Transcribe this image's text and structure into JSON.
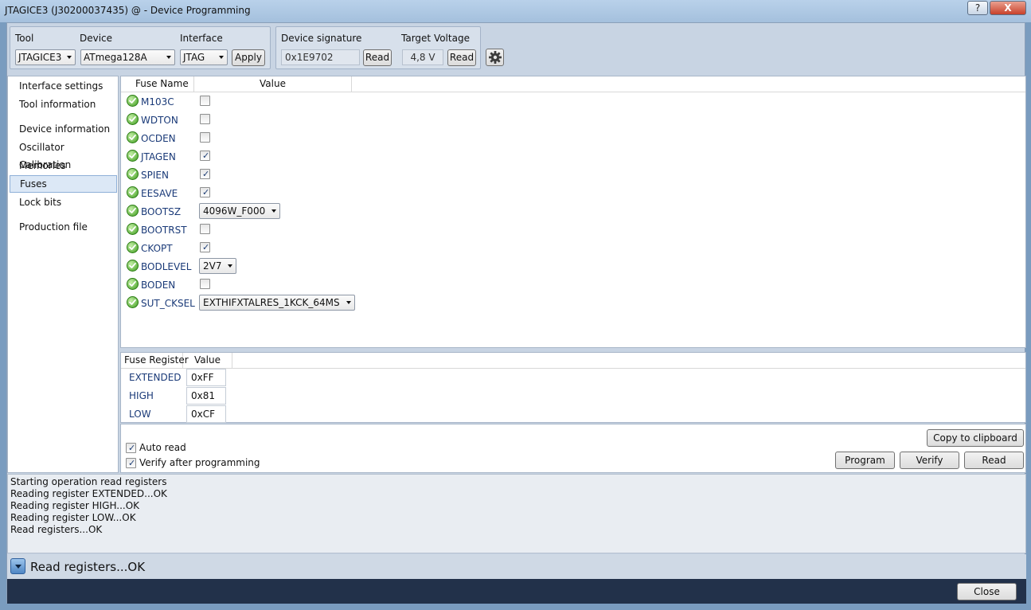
{
  "window": {
    "title": "JTAGICE3 (J30200037435) @  - Device Programming",
    "help_label": "?",
    "close_label": "X"
  },
  "toolbar": {
    "tool_label": "Tool",
    "tool_value": "JTAGICE3",
    "device_label": "Device",
    "device_value": "ATmega128A",
    "interface_label": "Interface",
    "interface_value": "JTAG",
    "apply_label": "Apply",
    "signature_label": "Device signature",
    "signature_value": "0x1E9702",
    "signature_read_label": "Read",
    "voltage_label": "Target Voltage",
    "voltage_value": "4,8 V",
    "voltage_read_label": "Read",
    "settings_icon": "gear-icon"
  },
  "sidebar": {
    "items": [
      {
        "label": "Interface settings"
      },
      {
        "label": "Tool information"
      },
      {
        "label": "Device information"
      },
      {
        "label": "Oscillator Calibration"
      },
      {
        "label": "Memories"
      },
      {
        "label": "Fuses",
        "selected": true
      },
      {
        "label": "Lock bits"
      },
      {
        "label": "Production file"
      }
    ]
  },
  "fuses": {
    "columns": {
      "name": "Fuse Name",
      "value": "Value"
    },
    "status_icon": "check-circle-icon",
    "rows": [
      {
        "name": "M103C",
        "type": "checkbox",
        "checked": false
      },
      {
        "name": "WDTON",
        "type": "checkbox",
        "checked": false
      },
      {
        "name": "OCDEN",
        "type": "checkbox",
        "checked": false
      },
      {
        "name": "JTAGEN",
        "type": "checkbox",
        "checked": true
      },
      {
        "name": "SPIEN",
        "type": "checkbox",
        "checked": true
      },
      {
        "name": "EESAVE",
        "type": "checkbox",
        "checked": true
      },
      {
        "name": "BOOTSZ",
        "type": "select",
        "value": "4096W_F000"
      },
      {
        "name": "BOOTRST",
        "type": "checkbox",
        "checked": false
      },
      {
        "name": "CKOPT",
        "type": "checkbox",
        "checked": true
      },
      {
        "name": "BODLEVEL",
        "type": "select",
        "value": "2V7"
      },
      {
        "name": "BODEN",
        "type": "checkbox",
        "checked": false
      },
      {
        "name": "SUT_CKSEL",
        "type": "select",
        "value": "EXTHIFXTALRES_1KCK_64MS"
      }
    ]
  },
  "registers": {
    "columns": {
      "name": "Fuse Register",
      "value": "Value"
    },
    "rows": [
      {
        "name": "EXTENDED",
        "value": "0xFF"
      },
      {
        "name": "HIGH",
        "value": "0x81"
      },
      {
        "name": "LOW",
        "value": "0xCF"
      }
    ]
  },
  "actions": {
    "auto_read_label": "Auto read",
    "auto_read_checked": true,
    "verify_label": "Verify after programming",
    "verify_checked": true,
    "copy_label": "Copy to clipboard",
    "program_label": "Program",
    "verify_button_label": "Verify",
    "read_label": "Read"
  },
  "log": {
    "lines": [
      "Starting operation read registers",
      "Reading register EXTENDED...OK",
      "Reading register HIGH...OK",
      "Reading register LOW...OK",
      "Read registers...OK"
    ]
  },
  "status": {
    "text": "Read registers...OK",
    "expand_icon": "chevron-down-icon"
  },
  "footer": {
    "close_label": "Close"
  },
  "colors": {
    "accent": "#3a6fb0",
    "fuse_name": "#1a3a78",
    "ok_green": "#3e9d1e",
    "bottom_bar": "#22314a"
  }
}
